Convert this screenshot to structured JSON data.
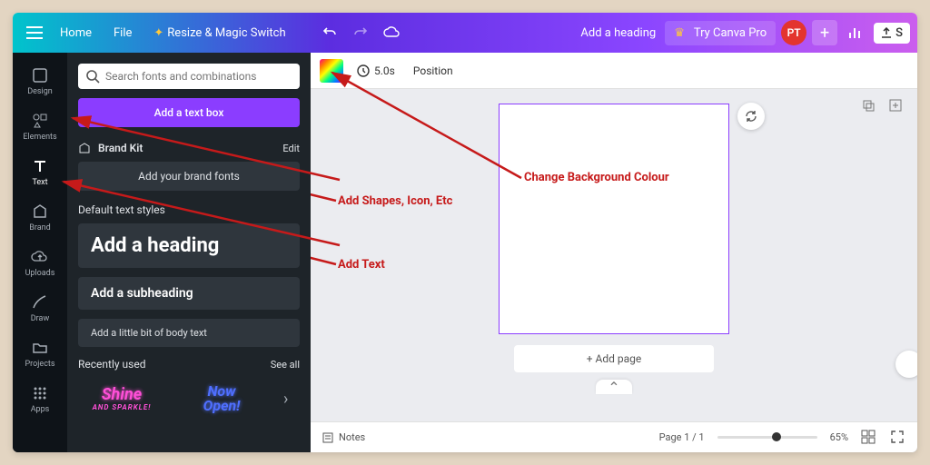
{
  "topbar": {
    "home": "Home",
    "file": "File",
    "magic": "Resize & Magic Switch",
    "add_heading": "Add a heading",
    "try_pro": "Try Canva Pro",
    "avatar": "PT",
    "share": "S"
  },
  "rail": [
    {
      "id": "design",
      "label": "Design"
    },
    {
      "id": "elements",
      "label": "Elements"
    },
    {
      "id": "text",
      "label": "Text"
    },
    {
      "id": "brand",
      "label": "Brand"
    },
    {
      "id": "uploads",
      "label": "Uploads"
    },
    {
      "id": "draw",
      "label": "Draw"
    },
    {
      "id": "projects",
      "label": "Projects"
    },
    {
      "id": "apps",
      "label": "Apps"
    }
  ],
  "panel": {
    "search_ph": "Search fonts and combinations",
    "add_text_box": "Add a text box",
    "brand_kit": "Brand Kit",
    "edit": "Edit",
    "add_brand_fonts": "Add your brand fonts",
    "default_styles": "Default text styles",
    "heading": "Add a heading",
    "subheading": "Add a subheading",
    "body": "Add a little bit of body text",
    "recent": "Recently used",
    "seeall": "See all",
    "thumb1a": "Shine",
    "thumb1b": "AND SPARKLE!",
    "thumb2a": "Now",
    "thumb2b": "Open!"
  },
  "ctx": {
    "duration": "5.0s",
    "position": "Position"
  },
  "stage": {
    "add_page": "+ Add page"
  },
  "bottombar": {
    "notes": "Notes",
    "page": "Page 1 / 1",
    "zoom": "65%"
  },
  "annotations": {
    "change_bg": "Change Background Colour",
    "add_shapes": "Add Shapes, Icon, Etc",
    "add_text": "Add Text"
  }
}
